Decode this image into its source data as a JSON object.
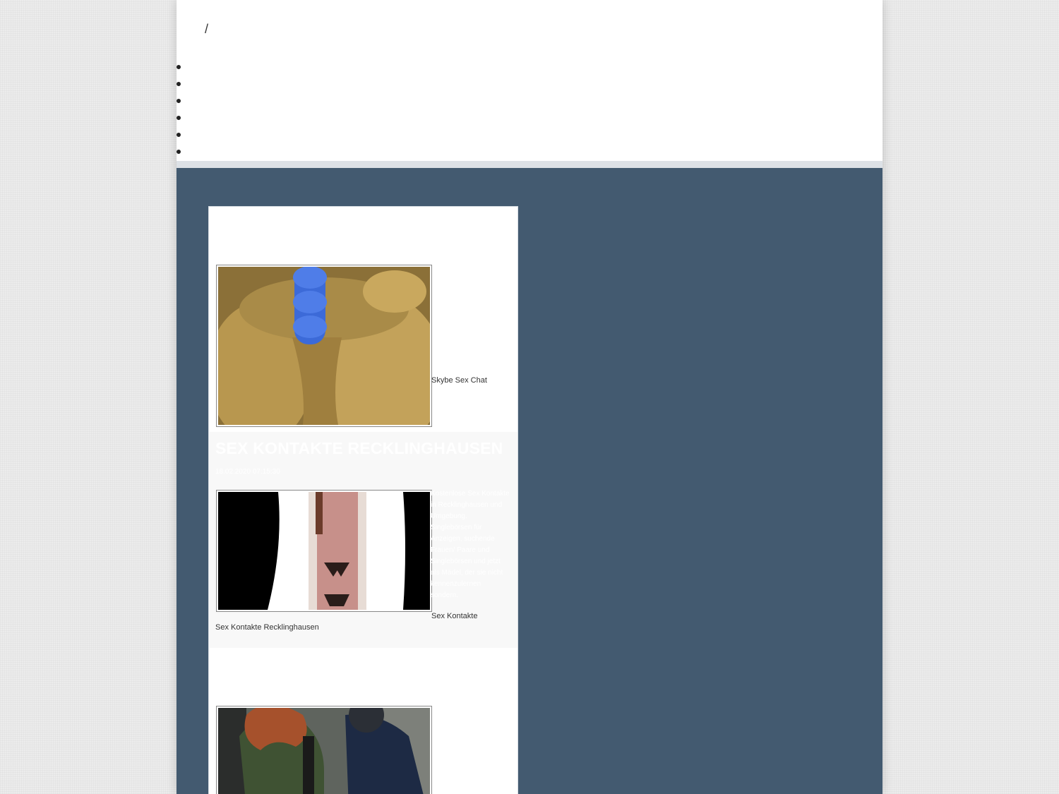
{
  "header": {
    "breadcrumb_separator": "/",
    "nav_items": [
      "",
      "",
      "",
      "",
      "",
      ""
    ]
  },
  "posts": {
    "first": {
      "image_alt": "Skybe Sex Chat",
      "link_text": "Skybe Sex Chat"
    },
    "article": {
      "title": "Sex Kontakte Recklinghausen",
      "date": "18.02.2020 07:15:30",
      "description": "Kostenlose Sex Kontakte in Recklinghausen und Umgebung. Singlebörsen für Anzeigen, suchende Frauen/ Paare und Singlebörsen und jetzt als Mädel, der sie nicht kennenzulernen sondern.",
      "link_text": "Sex Kontakte Recklinghausen"
    },
    "third": {
      "image_alt": ""
    }
  },
  "colors": {
    "page_background": "#ececec",
    "content_background": "#435a70",
    "header_background": "#ffffff",
    "card_background": "#ffffff",
    "article_background": "#f8f8f8"
  }
}
